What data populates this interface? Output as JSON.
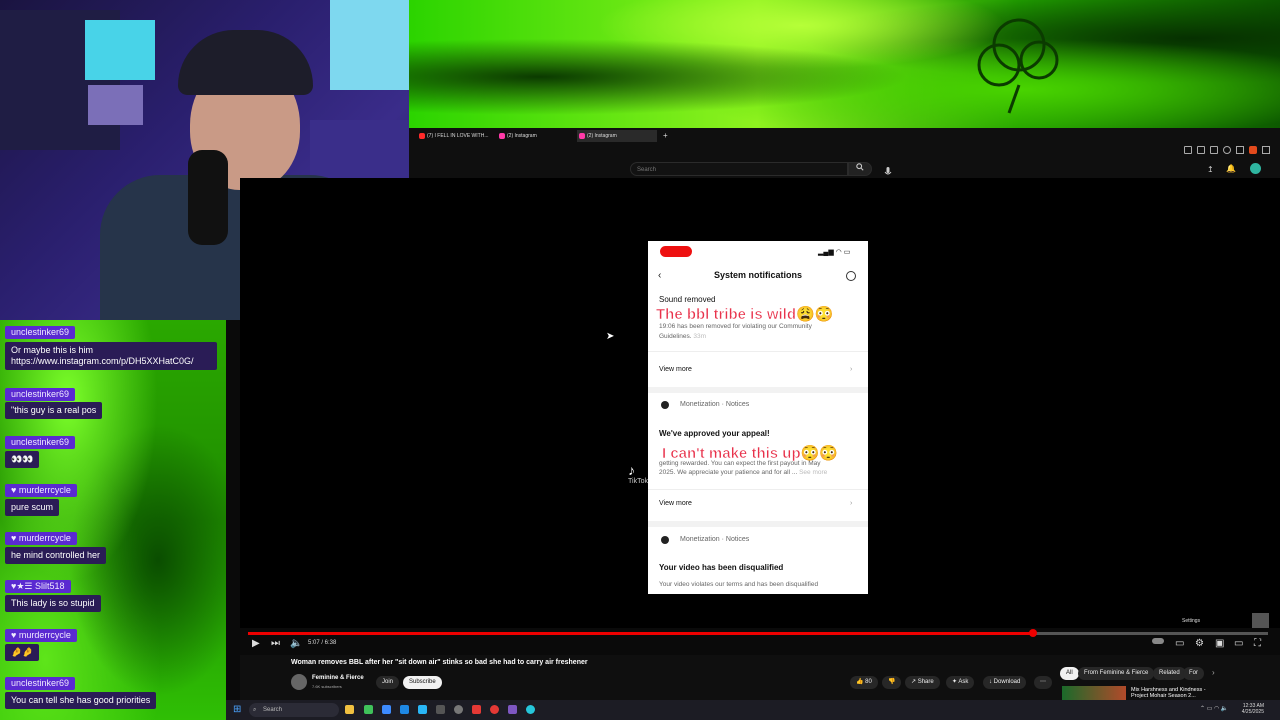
{
  "colors": {
    "accent_green": "#7cff2a",
    "chat_user_bg": "#5a2ad1",
    "chat_msg_bg": "#2a1c56",
    "brand_red": "#ff0000"
  },
  "browser": {
    "tabs": [
      {
        "label": "(7) I FELL IN LOVE WITH...",
        "color": "#ff2a2a"
      },
      {
        "label": "(2) Instagram",
        "color": "#ff3aa8"
      },
      {
        "label": "(2) Instagram",
        "color": "#ff3aa8"
      }
    ],
    "search_placeholder": "Search"
  },
  "phone": {
    "header_title": "System notifications",
    "sound_removed": "Sound removed",
    "sound_body_1": "19:06 has been removed for violating our Community",
    "sound_body_2": "Guidelines.",
    "time_ago": "33m",
    "view_more_1": "View more",
    "monetization_1": "Monetization · Notices",
    "approved_title": "We've approved your appeal!",
    "approved_body_1": "getting rewarded. You can expect the first payout in May",
    "approved_body_2": "2025. We appreciate your patience and for all ...",
    "see_more": "See more",
    "view_more_2": "View more",
    "monetization_2": "Monetization · Notices",
    "disqualified_title": "Your video has been disqualified",
    "disqualified_body": "Your video violates our terms and has been disqualified",
    "overlay_1": "The bbl tribe is wild😩😳",
    "overlay_2": "I can't make this up😳😳",
    "watermark": "TikTok"
  },
  "chat": [
    {
      "user": "unclestinker69",
      "msg": "Or maybe this is him https://www.instagram.com/p/DH5XXHatC0G/"
    },
    {
      "user": "unclestinker69",
      "msg": "\"this guy is a real pos"
    },
    {
      "user": "unclestinker69",
      "msg": "👀👀"
    },
    {
      "user": "murderrcycle",
      "msg": "pure scum"
    },
    {
      "user": "murderrcycle",
      "msg": "he mind controlled her"
    },
    {
      "user": "Slilt518",
      "msg": "This lady is so stupid"
    },
    {
      "user": "murderrcycle",
      "msg": "🤌🤌"
    },
    {
      "user": "unclestinker69",
      "msg": "You can tell she has good priorities"
    }
  ],
  "player": {
    "time": "5:07 / 6:38",
    "progress": 0.77,
    "settings_tooltip": "Settings"
  },
  "video": {
    "title": "Woman removes BBL after her \"sit down air\" stinks so bad she had to carry air freshener",
    "channel": "Feminine & Fierce",
    "subscribers": "7.6K subscribers",
    "join": "Join",
    "subscribe": "Subscribe",
    "likes": "80",
    "share": "Share",
    "ask": "Ask",
    "download": "Download",
    "chips": [
      "All",
      "From Feminine & Fierce",
      "Related",
      "For"
    ],
    "rec_title": "Mix Harshness and Kindness - Project Mohair Season 2..."
  },
  "taskbar": {
    "search": "Search",
    "time": "12:33 AM",
    "date": "4/25/2025"
  }
}
